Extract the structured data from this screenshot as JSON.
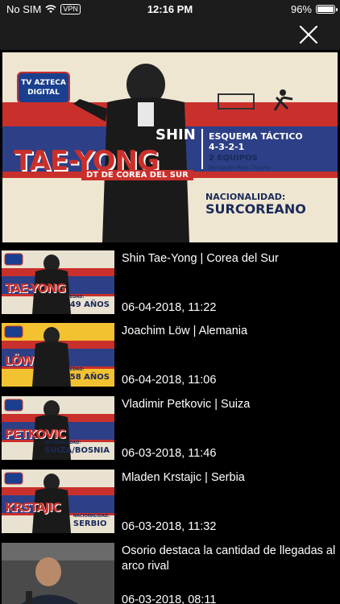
{
  "status_bar": {
    "carrier": "No SIM",
    "vpn": "VPN",
    "time": "12:16 PM",
    "battery": "96%",
    "battery_level": 0.96
  },
  "header": {
    "close_icon": "close-icon"
  },
  "hero": {
    "logo": "TV AZTECA DIGITAL",
    "first_name": "SHIN",
    "last_name": "TAE-YONG",
    "role": "DT DE COREA DEL SUR",
    "scheme_label": "ESQUEMA TÁCTICO",
    "scheme": "4-3-2-1",
    "teams": "2 EQUIPOS",
    "club": "Seongnam Ilhwa Chunma",
    "nationality_label": "NACIONALIDAD:",
    "nationality": "SURCOREANO"
  },
  "items": [
    {
      "title": "Shin Tae-Yong  | Corea del Sur",
      "date": "06-04-2018, 11:22",
      "thumb_name": "TAE-YONG",
      "thumb_age_label": "EDAD:",
      "thumb_age": "49 AÑOS",
      "thumb_bg": "#e9e2d0"
    },
    {
      "title": "Joachim Löw | Alemania",
      "date": "06-04-2018, 11:06",
      "thumb_name": "LÖW",
      "thumb_age_label": "EDAD:",
      "thumb_age": "58 AÑOS",
      "thumb_bg": "#f2c230"
    },
    {
      "title": "Vladimir Petkovic | Suiza",
      "date": "06-03-2018, 11:46",
      "thumb_name": "PETKOVIC",
      "thumb_age_label": "NACIONALIDAD:",
      "thumb_age": "SUIZA/BOSNIA",
      "thumb_bg": "#e9e2d0"
    },
    {
      "title": "Mladen Krstajic | Serbia",
      "date": "06-03-2018, 11:32",
      "thumb_name": "KRSTAJIC",
      "thumb_age_label": "NACIONALIDAD:",
      "thumb_age": "SERBIO",
      "thumb_bg": "#e9e2d0"
    },
    {
      "title": "Osorio destaca la cantidad de llegadas al arco rival",
      "date": "06-03-2018, 08:11",
      "thumb_name": "",
      "thumb_age_label": "",
      "thumb_age": "",
      "thumb_bg": "#4a4a4a"
    }
  ]
}
